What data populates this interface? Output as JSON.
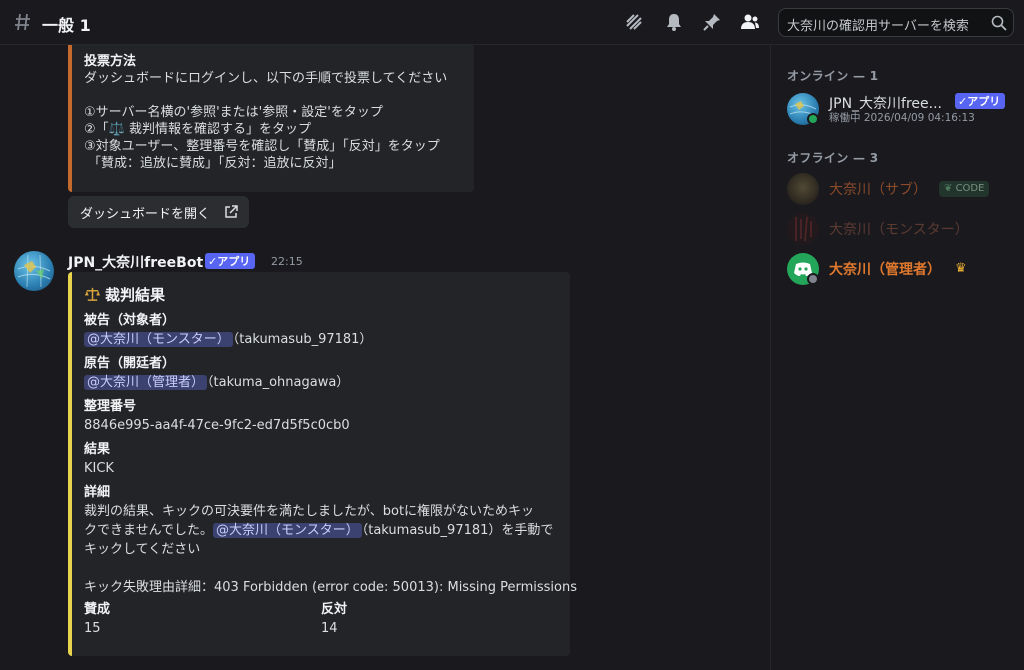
{
  "header": {
    "channel_name": "一般 1",
    "search_placeholder": "大奈川の確認用サーバーを検索"
  },
  "embed_instructions": {
    "title": "投票方法",
    "lines": [
      "ダッシュボードにログインし、以下の手順で投票してください",
      "①サーバー名横の'参照'または'参照・設定'をタップ",
      "②「⚖️ 裁判情報を確認する」をタップ",
      "③対象ユーザー、整理番号を確認し「賛成」「反対」をタップ",
      "「賛成：追放に賛成」「反対：追放に反対」"
    ],
    "accent_color": "#c46a2c"
  },
  "dashboard_button": {
    "label": "ダッシュボードを開く"
  },
  "message": {
    "author": "JPN_大奈川freeBot",
    "badge": "✓アプリ",
    "time": "22:15"
  },
  "embed_result": {
    "title": "裁判結果",
    "accent_color": "#e8d44d",
    "defendant_label": "被告（対象者）",
    "defendant_mention": "@大奈川（モンスター）",
    "defendant_id": "（takumasub_97181）",
    "plaintiff_label": "原告（開廷者）",
    "plaintiff_mention": "@大奈川（管理者）",
    "plaintiff_id": "（takuma_ohnagawa）",
    "case_label": "整理番号",
    "case_value": "8846e995-aa4f-47ce-9fc2-ed7d5f5c0cb0",
    "result_label": "結果",
    "result_value": "KICK",
    "detail_label": "詳細",
    "detail_line1": "裁判の結果、キックの可決要件を満たしましたが、botに権限がないためキッ",
    "detail_line2": "クできませんでした。",
    "detail_mention": "@大奈川（モンスター）",
    "detail_line2b": "（takumasub_97181）を手動で",
    "detail_line3": "キックしてください",
    "detail_error": "キック失敗理由詳細：403 Forbidden (error code: 50013): Missing Permissions",
    "agree_label": "賛成",
    "agree_value": "15",
    "disagree_label": "反対",
    "disagree_value": "14"
  },
  "members": {
    "online_label": "オンライン — 1",
    "offline_label": "オフライン — 3",
    "online": [
      {
        "name": "JPN_大奈川free...",
        "badge": "✓アプリ",
        "status": "稼働中 2026/04/09 04:16:13"
      }
    ],
    "offline": [
      {
        "name": "大奈川（サブ）",
        "tag": "CODE",
        "color": "#8a4a2a"
      },
      {
        "name": "大奈川（モンスター）",
        "color": "#5c3a32"
      },
      {
        "name": "大奈川（管理者）",
        "color": "#e0782e",
        "crown": true
      }
    ]
  }
}
